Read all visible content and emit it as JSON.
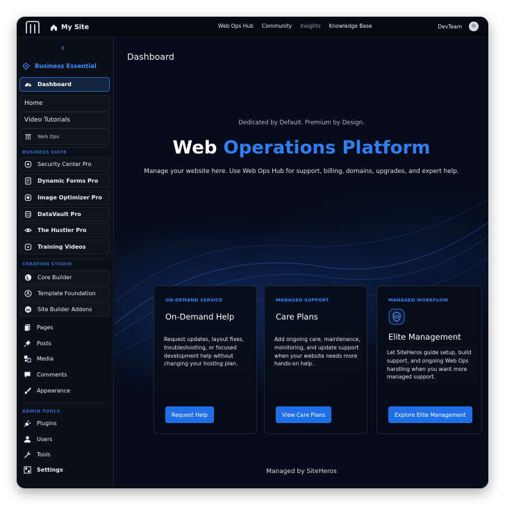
{
  "topbar": {
    "site_title": "My Site",
    "nav": [
      "Web Ops Hub",
      "Community",
      "Insights",
      "Knowledge Base"
    ],
    "user_name": "DevTeam"
  },
  "sidebar": {
    "brand": "Business Essential",
    "dashboard": "Dashboard",
    "sub_items": [
      "Home",
      "Video Tutorials"
    ],
    "web_ops": "Web Ops",
    "section_business": "BUSINESS SUITE",
    "business_items": [
      "Security Center Pro",
      "Dynamic Forms Pro",
      "Image Optimizer Pro",
      "DataVault Pro",
      "The Hustler Pro",
      "Training Videos"
    ],
    "section_creation": "CREATION STUDIO",
    "creation_items": [
      "Core Builder",
      "Template Foundation",
      "Site Builder Addons"
    ],
    "wp_items": [
      "Pages",
      "Posts",
      "Media",
      "Comments",
      "Appearance"
    ],
    "section_admin": "ADMIN TOOLS",
    "admin_items": [
      "Plugins",
      "Users",
      "Tools",
      "Settings"
    ]
  },
  "main": {
    "page_title": "Dashboard",
    "tagline": "Dedicated by Default. Premium by Design.",
    "hero_prefix": "Web ",
    "hero_accent": "Operations Platform",
    "description": "Manage your website here. Use Web Ops Hub for support, billing, domains, upgrades, and expert help.",
    "cards": [
      {
        "eyebrow": "ON-DEMAND SERVICE",
        "title": "On-Demand Help",
        "body": "Request updates, layout fixes, troubleshooting, or focused development help without changing your hosting plan.",
        "button": "Request Help"
      },
      {
        "eyebrow": "MANAGED SUPPORT",
        "title": "Care Plans",
        "body": "Add ongoing care, maintenance, monitoring, and update support when your website needs more hands-on help.",
        "button": "View Care Plans"
      },
      {
        "eyebrow": "MANAGED WORKFLOW",
        "title": "Elite Management",
        "body": "Let SiteHeros guide setup, build support, and ongoing Web Ops handling when you want more managed support.",
        "button": "Explore Elite Management"
      }
    ],
    "footer": "Managed by SiteHeros"
  },
  "colors": {
    "accent": "#2f7ff5",
    "background": "#050b18",
    "sidebar": "#0b0f17",
    "button": "#1f6fe6"
  }
}
